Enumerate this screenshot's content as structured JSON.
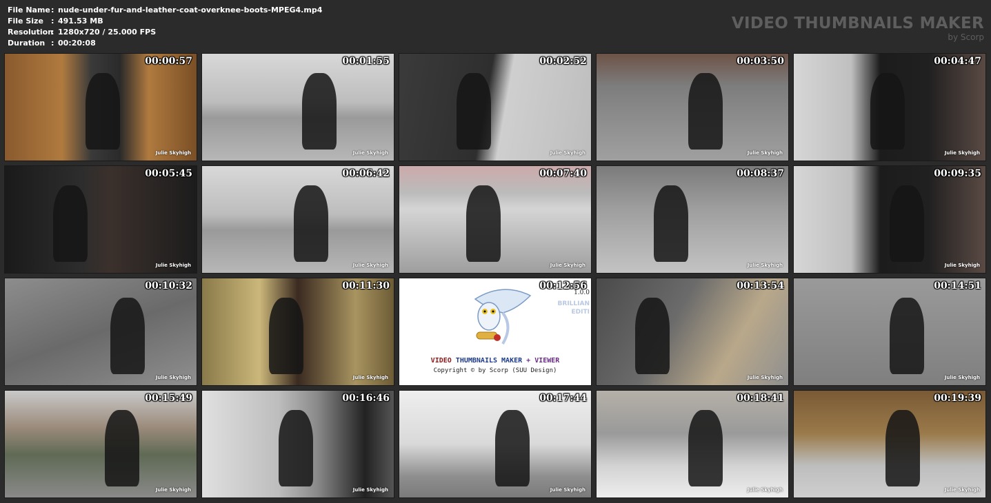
{
  "file_info": {
    "file_name_label": "File Name",
    "file_name_value": "nude-under-fur-and-leather-coat-overknee-boots-MPEG4.mp4",
    "file_size_label": "File Size",
    "file_size_value": "491.53 MB",
    "resolution_label": "Resolution",
    "resolution_value": "1280x720 / 25.000 FPS",
    "duration_label": "Duration",
    "duration_value": "00:20:08",
    "separator": ":"
  },
  "brand": {
    "title": "VIDEO THUMBNAILS MAKER",
    "subtitle": "by Scorp"
  },
  "watermark": "Julie Skyhigh",
  "thumbnails": [
    {
      "time": "00:00:57",
      "scene": "elevator"
    },
    {
      "time": "00:01:55",
      "scene": "street"
    },
    {
      "time": "00:02:52",
      "scene": "shutter"
    },
    {
      "time": "00:03:50",
      "scene": "cobble"
    },
    {
      "time": "00:04:47",
      "scene": "door"
    },
    {
      "time": "00:05:45",
      "scene": "closeup"
    },
    {
      "time": "00:06:42",
      "scene": "street"
    },
    {
      "time": "00:07:40",
      "scene": "car"
    },
    {
      "time": "00:08:37",
      "scene": "boots"
    },
    {
      "time": "00:09:35",
      "scene": "door"
    },
    {
      "time": "00:10:32",
      "scene": "post"
    },
    {
      "time": "00:11:30",
      "scene": "hall"
    },
    {
      "time": "00:12:56",
      "scene": "promo"
    },
    {
      "time": "00:13:54",
      "scene": "closeup2"
    },
    {
      "time": "00:14:51",
      "scene": "tiles"
    },
    {
      "time": "00:15:49",
      "scene": "park"
    },
    {
      "time": "00:16:46",
      "scene": "cars"
    },
    {
      "time": "00:17:44",
      "scene": "wall"
    },
    {
      "time": "00:18:41",
      "scene": "crosswalk"
    },
    {
      "time": "00:19:39",
      "scene": "shop"
    }
  ],
  "promo": {
    "version": "1.0.0",
    "edition_1": "BRILLIAN",
    "edition_2": "EDITI",
    "line_part1": "VIDEO",
    "line_part2": "THUMBNAILS MAKER",
    "line_part3": "+ VIEWER",
    "copyright": "Copyright © by Scorp (SUU Design)"
  },
  "colors": {
    "background": "#2b2b2b",
    "brand_text": "#5e5e5e",
    "timestamp": "#ffffff"
  }
}
